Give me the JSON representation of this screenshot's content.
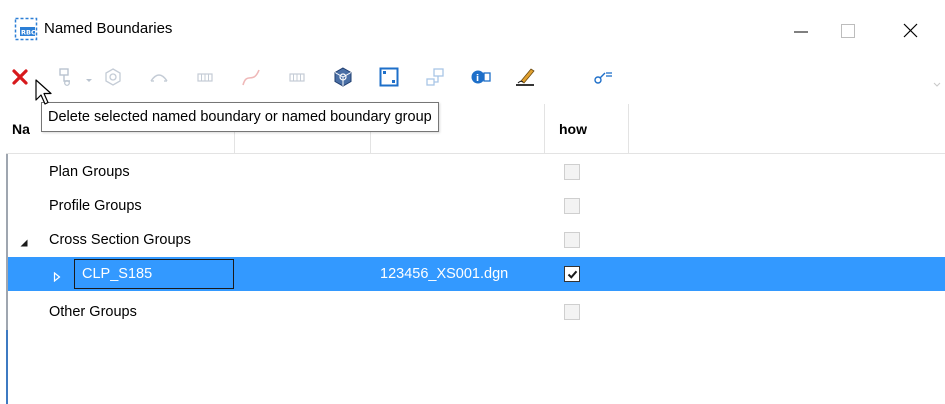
{
  "window": {
    "title": "Named Boundaries"
  },
  "toolbar": {
    "tooltip": "Delete selected named boundary or named boundary group"
  },
  "grid": {
    "columns": [
      {
        "label": "Na"
      },
      {
        "label": ""
      },
      {
        "label": ""
      },
      {
        "label": "how"
      }
    ],
    "rows": [
      {
        "label": "Plan Groups",
        "file": "",
        "checked": false
      },
      {
        "label": "Profile Groups",
        "file": "",
        "checked": false
      },
      {
        "label": "Cross Section Groups",
        "file": "",
        "checked": false
      },
      {
        "label": "CLP_S185",
        "file": "123456_XS001.dgn",
        "checked": true
      },
      {
        "label": "Other Groups",
        "file": "",
        "checked": false
      }
    ]
  },
  "colors": {
    "selection": "#3399ff",
    "delete_red": "#d7191c",
    "accent_blue": "#1e6fc9"
  }
}
